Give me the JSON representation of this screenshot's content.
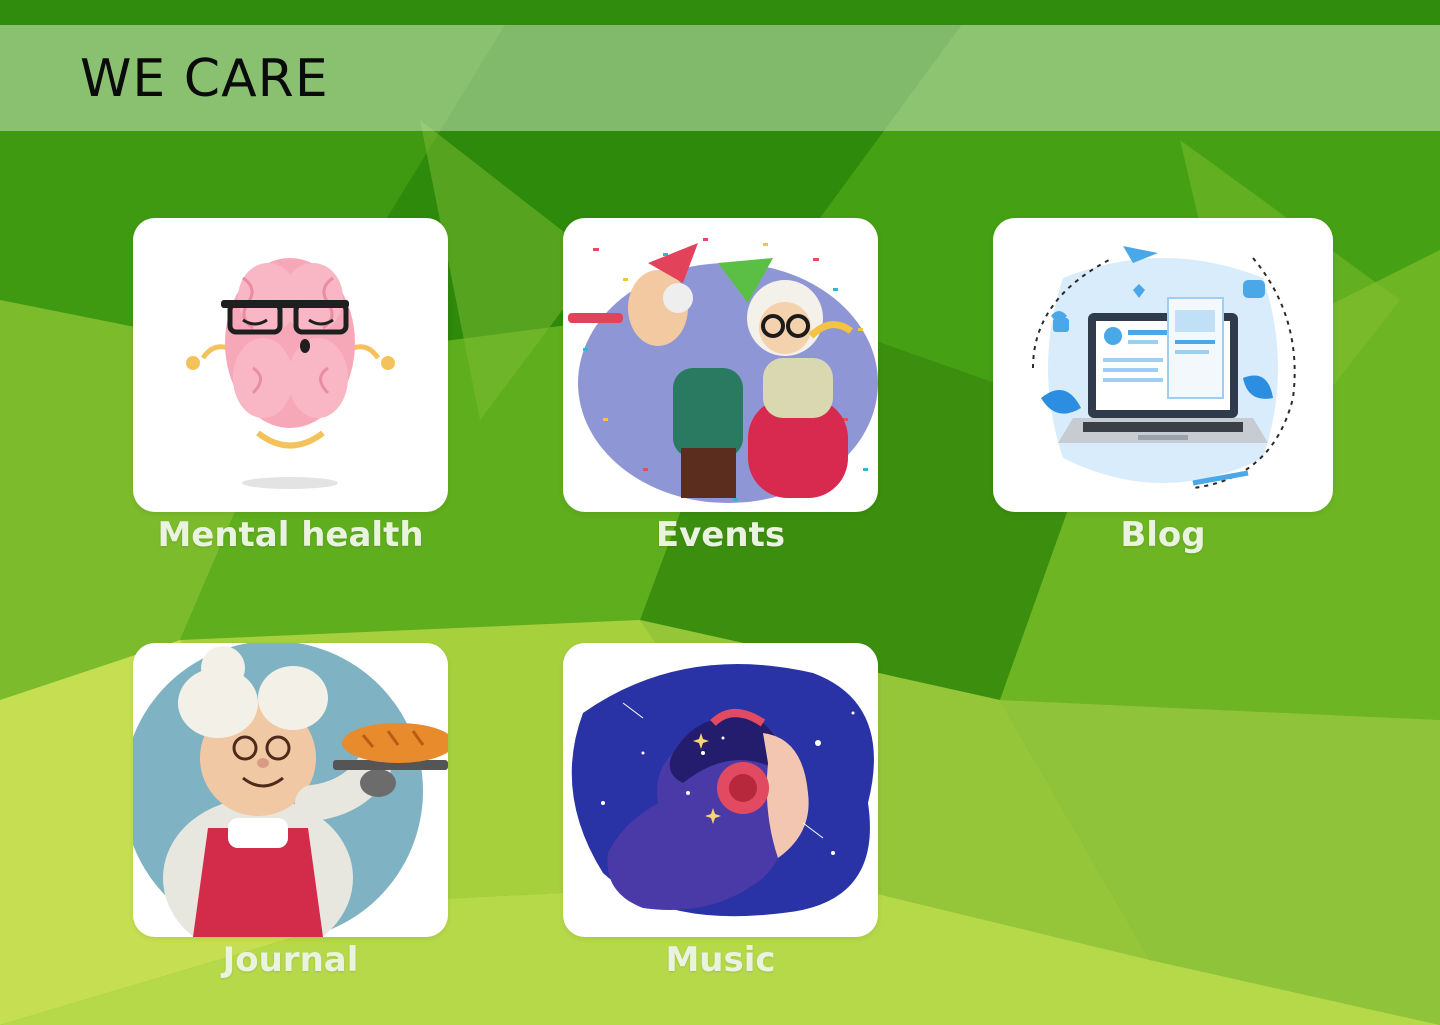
{
  "header": {
    "title": "WE CARE"
  },
  "tiles": [
    {
      "label": "Mental health",
      "icon": "meditating-brain-icon"
    },
    {
      "label": "Events",
      "icon": "party-elderly-couple-icon"
    },
    {
      "label": "Blog",
      "icon": "laptop-blog-icon"
    },
    {
      "label": "Journal",
      "icon": "grandma-baker-icon"
    },
    {
      "label": "Music",
      "icon": "headphones-galaxy-icon"
    }
  ],
  "colors": {
    "background": "#4f9e12",
    "header_overlay": "#c8e1be",
    "label_text": "#e9f3df",
    "card_background": "#ffffff"
  }
}
